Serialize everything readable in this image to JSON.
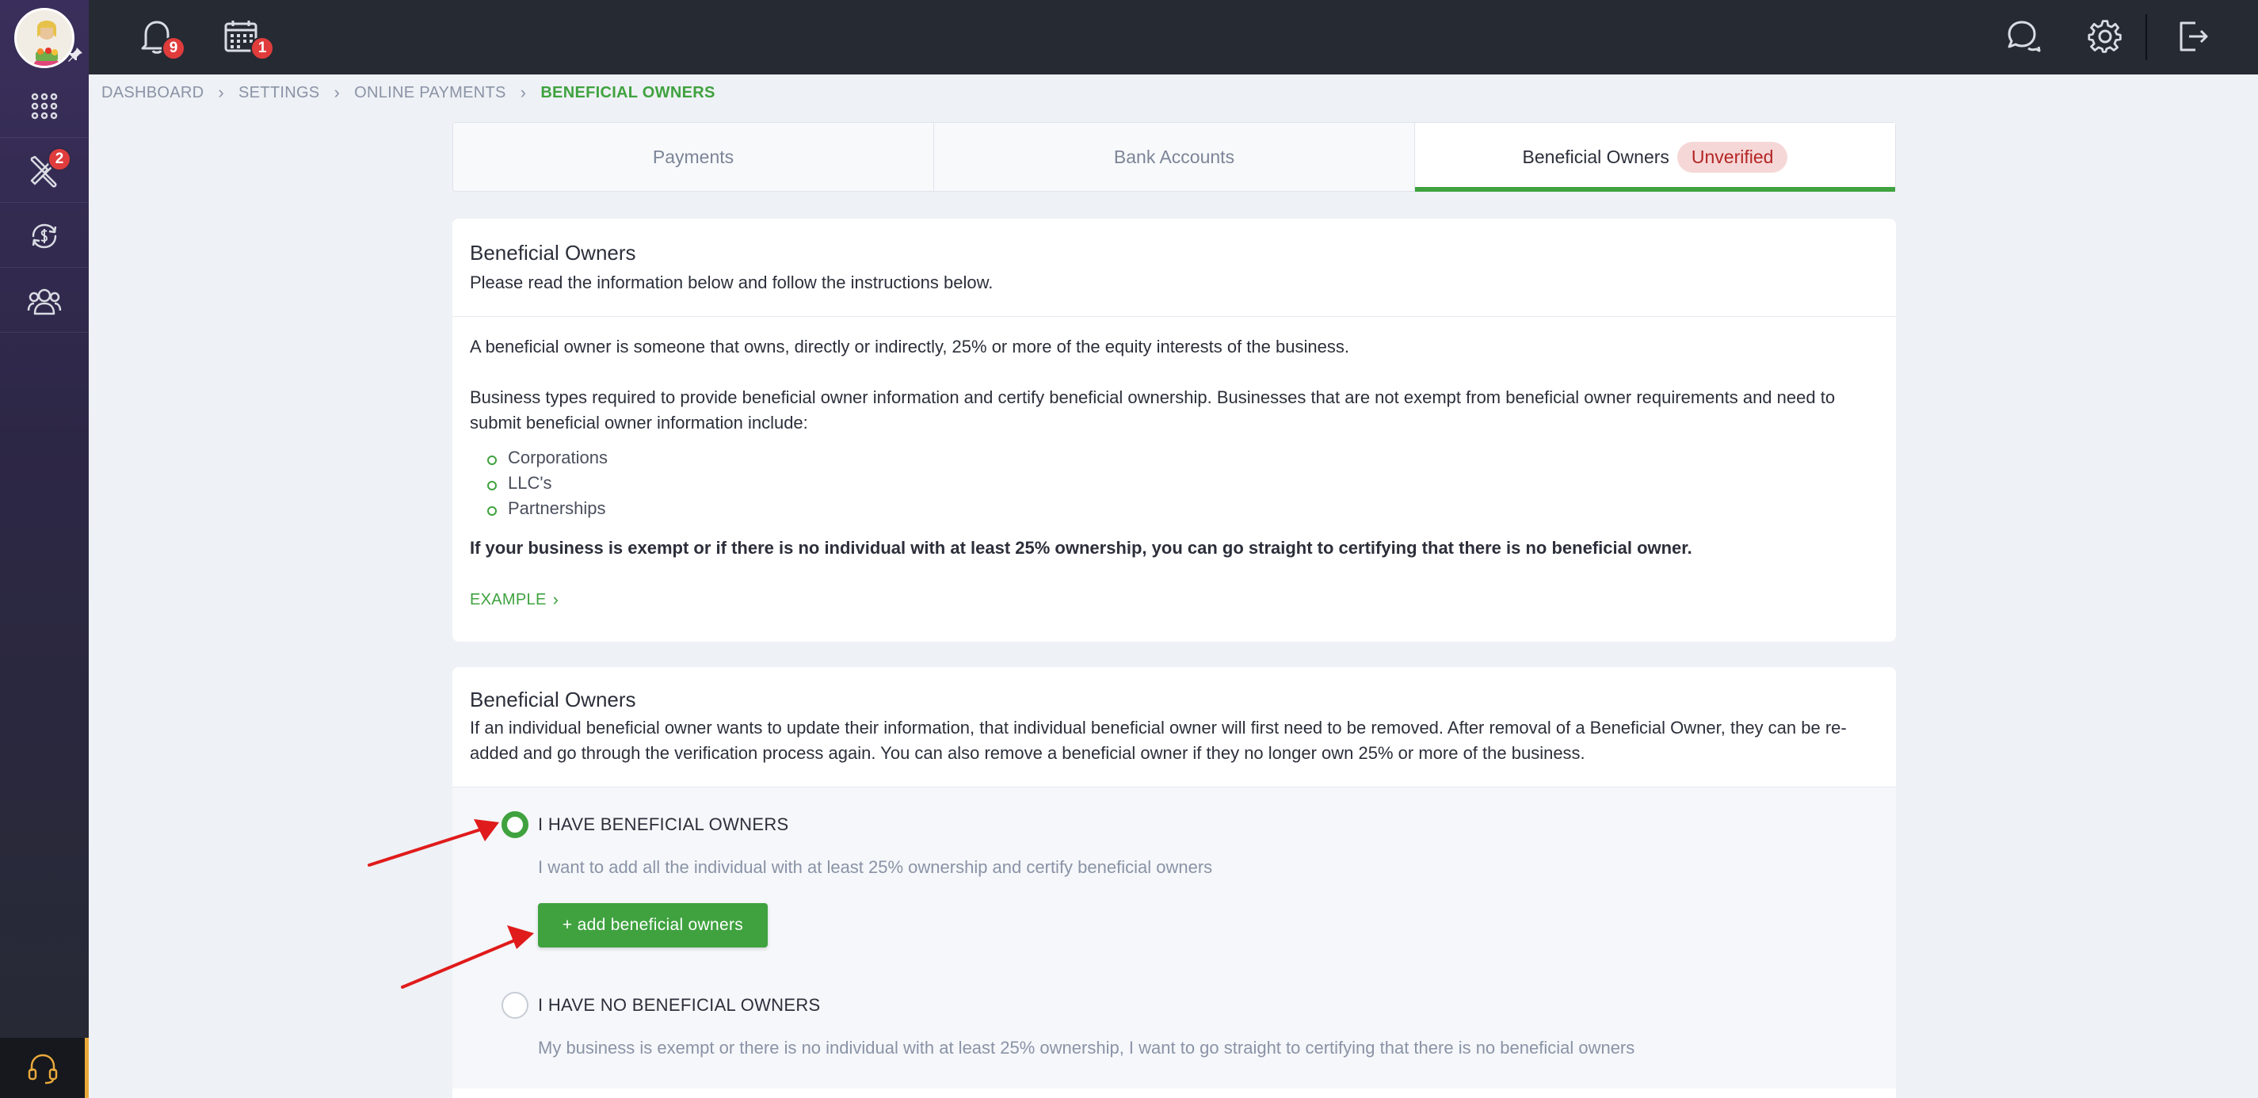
{
  "topbar": {
    "notifications_count": "9",
    "calendar_count": "1"
  },
  "sidebar": {
    "tools_badge": "2",
    "items": [
      "apps-grid-icon",
      "tools-icon",
      "exchange-icon",
      "people-icon"
    ]
  },
  "breadcrumb": {
    "items": [
      "DASHBOARD",
      "SETTINGS",
      "ONLINE PAYMENTS",
      "BENEFICIAL OWNERS"
    ]
  },
  "tabs": {
    "items": [
      "Payments",
      "Bank Accounts",
      "Beneficial Owners"
    ],
    "status_badge": "Unverified"
  },
  "info_card": {
    "title": "Beneficial Owners",
    "subtitle": "Please read the information below and follow the instructions below.",
    "paragraph1": "A beneficial owner is someone that owns, directly or indirectly, 25% or more of the equity interests of the business.",
    "paragraph2": "Business types required to provide beneficial owner information and certify beneficial ownership. Businesses that are not exempt from beneficial owner requirements and need to submit beneficial owner information include:",
    "list": [
      "Corporations",
      "LLC's",
      "Partnerships"
    ],
    "bold_note": "If your business is exempt or if there is no individual with at least 25% ownership, you can go straight to certifying that there is no beneficial owner.",
    "example_link": "EXAMPLE"
  },
  "owners_card": {
    "title": "Beneficial Owners",
    "subtitle": "If an individual beneficial owner wants to update their information, that individual beneficial owner will first need to be removed. After removal of a Beneficial Owner, they can be re-added and go through the verification process again. You can also remove a beneficial owner if they no longer own 25% or more of the business.",
    "option1_label": "I HAVE BENEFICIAL OWNERS",
    "option1_desc": "I want to add all the individual with at least 25% ownership and certify beneficial owners",
    "add_button": "+ add beneficial owners",
    "option2_label": "I HAVE NO BENEFICIAL OWNERS",
    "option2_desc": "My business is exempt or there is no individual with at least 25% ownership, I want to go straight to certifying that there is no beneficial owners",
    "selected_option": "I HAVE BENEFICIAL OWNERS"
  },
  "colors": {
    "accent": "#3fa23f",
    "topbar": "#262a33",
    "badge": "#e03c3c",
    "annotation_arrow": "#e01b1b"
  }
}
